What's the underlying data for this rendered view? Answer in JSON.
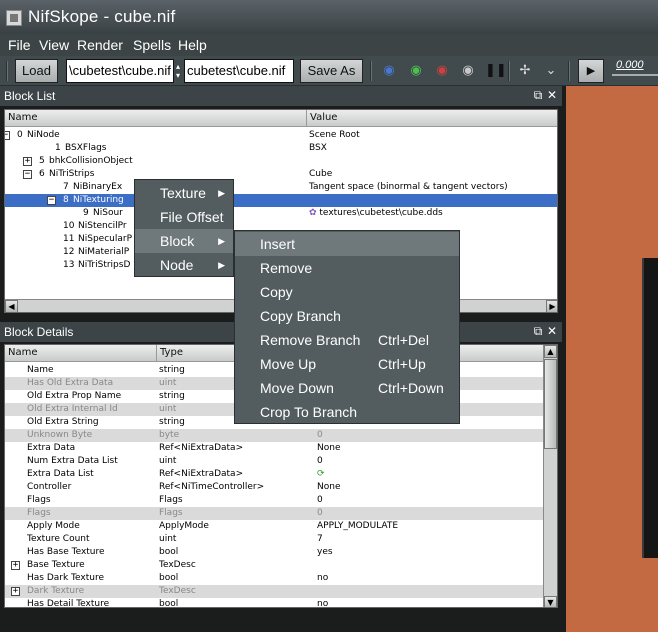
{
  "window": {
    "title": "NifSkope - cube.nif",
    "app_icon": "nifskope-icon"
  },
  "menubar": [
    "File",
    "View",
    "Render",
    "Spells",
    "Help"
  ],
  "toolbar": {
    "load_label": "Load",
    "load_path": "\\cubetest\\cube.nif",
    "save_path": "cubetest\\cube.nif",
    "save_label": "Save As",
    "icons": [
      "eye-blue-icon",
      "eye-green-icon",
      "eye-red-icon",
      "eye-gray-icon",
      "footprints-icon",
      "axes-icon",
      "chevron-down-icon",
      "play-icon"
    ],
    "time_value": "0.000"
  },
  "block_list": {
    "title": "Block List",
    "columns": [
      "Name",
      "Value"
    ],
    "rows": [
      {
        "index": "0",
        "name": "NiNode",
        "value": "Scene Root",
        "expander": "−"
      },
      {
        "index": "1",
        "name": "BSXFlags",
        "value": "BSX",
        "expander": ""
      },
      {
        "index": "5",
        "name": "bhkCollisionObject",
        "value": "",
        "expander": "+"
      },
      {
        "index": "6",
        "name": "NiTriStrips",
        "value": "Cube",
        "expander": "−"
      },
      {
        "index": "7",
        "name": "NiBinaryEx",
        "value": "Tangent space (binormal & tangent vectors)",
        "expander": ""
      },
      {
        "index": "8",
        "name": "NiTexturing",
        "value": "",
        "expander": "−"
      },
      {
        "index": "9",
        "name": "NiSour",
        "value": "textures\\cubetest\\cube.dds",
        "expander": ""
      },
      {
        "index": "10",
        "name": "NiStencilPr",
        "value": "",
        "expander": ""
      },
      {
        "index": "11",
        "name": "NiSpecularP",
        "value": "",
        "expander": ""
      },
      {
        "index": "12",
        "name": "NiMaterialP",
        "value": "",
        "expander": ""
      },
      {
        "index": "13",
        "name": "NiTriStripsD",
        "value": "",
        "expander": ""
      }
    ]
  },
  "block_details": {
    "title": "Block Details",
    "columns": [
      "Name",
      "Type"
    ],
    "rows": [
      {
        "name": "Name",
        "type": "string",
        "value": "",
        "grey": false,
        "expander": ""
      },
      {
        "name": "Has Old Extra Data",
        "type": "uint",
        "value": "",
        "grey": true,
        "expander": ""
      },
      {
        "name": "Old Extra Prop Name",
        "type": "string",
        "value": "",
        "grey": false,
        "expander": ""
      },
      {
        "name": "Old Extra Internal Id",
        "type": "uint",
        "value": "",
        "grey": true,
        "expander": ""
      },
      {
        "name": "Old Extra String",
        "type": "string",
        "value": "",
        "grey": false,
        "expander": ""
      },
      {
        "name": "Unknown Byte",
        "type": "byte",
        "value": "0",
        "grey": true,
        "expander": ""
      },
      {
        "name": "Extra Data",
        "type": "Ref<NiExtraData>",
        "value": "None",
        "grey": false,
        "expander": ""
      },
      {
        "name": "Num Extra Data List",
        "type": "uint",
        "value": "0",
        "grey": false,
        "expander": ""
      },
      {
        "name": "Extra Data List",
        "type": "Ref<NiExtraData>",
        "value": "",
        "grey": false,
        "expander": ""
      },
      {
        "name": "Controller",
        "type": "Ref<NiTimeController>",
        "value": "None",
        "grey": false,
        "expander": ""
      },
      {
        "name": "Flags",
        "type": "Flags",
        "value": "0",
        "grey": false,
        "expander": ""
      },
      {
        "name": "Flags",
        "type": "Flags",
        "value": "0",
        "grey": true,
        "expander": ""
      },
      {
        "name": "Apply Mode",
        "type": "ApplyMode",
        "value": "APPLY_MODULATE",
        "grey": false,
        "expander": ""
      },
      {
        "name": "Texture Count",
        "type": "uint",
        "value": "7",
        "grey": false,
        "expander": ""
      },
      {
        "name": "Has Base Texture",
        "type": "bool",
        "value": "yes",
        "grey": false,
        "expander": ""
      },
      {
        "name": "Base Texture",
        "type": "TexDesc",
        "value": "",
        "grey": false,
        "expander": "+"
      },
      {
        "name": "Has Dark Texture",
        "type": "bool",
        "value": "no",
        "grey": false,
        "expander": ""
      },
      {
        "name": "Dark Texture",
        "type": "TexDesc",
        "value": "",
        "grey": true,
        "expander": "+"
      },
      {
        "name": "Has Detail Texture",
        "type": "bool",
        "value": "no",
        "grey": false,
        "expander": ""
      }
    ]
  },
  "context_menu": {
    "items": [
      {
        "label": "Texture",
        "submenu": true
      },
      {
        "label": "File Offset",
        "submenu": false
      },
      {
        "label": "Block",
        "submenu": true
      },
      {
        "label": "Node",
        "submenu": true
      }
    ],
    "highlighted": "Block"
  },
  "block_submenu": {
    "items": [
      {
        "label": "Insert",
        "shortcut": ""
      },
      {
        "label": "Remove",
        "shortcut": ""
      },
      {
        "label": "Copy",
        "shortcut": ""
      },
      {
        "label": "Copy Branch",
        "shortcut": ""
      },
      {
        "label": "Remove Branch",
        "shortcut": "Ctrl+Del"
      },
      {
        "label": "Move Up",
        "shortcut": "Ctrl+Up"
      },
      {
        "label": "Move Down",
        "shortcut": "Ctrl+Down"
      },
      {
        "label": "Crop To Branch",
        "shortcut": ""
      }
    ],
    "highlighted": "Insert"
  },
  "colors": {
    "selection": "#3d6ec6",
    "viewport": "#c46a43",
    "menu_bg": "#535c5e"
  }
}
